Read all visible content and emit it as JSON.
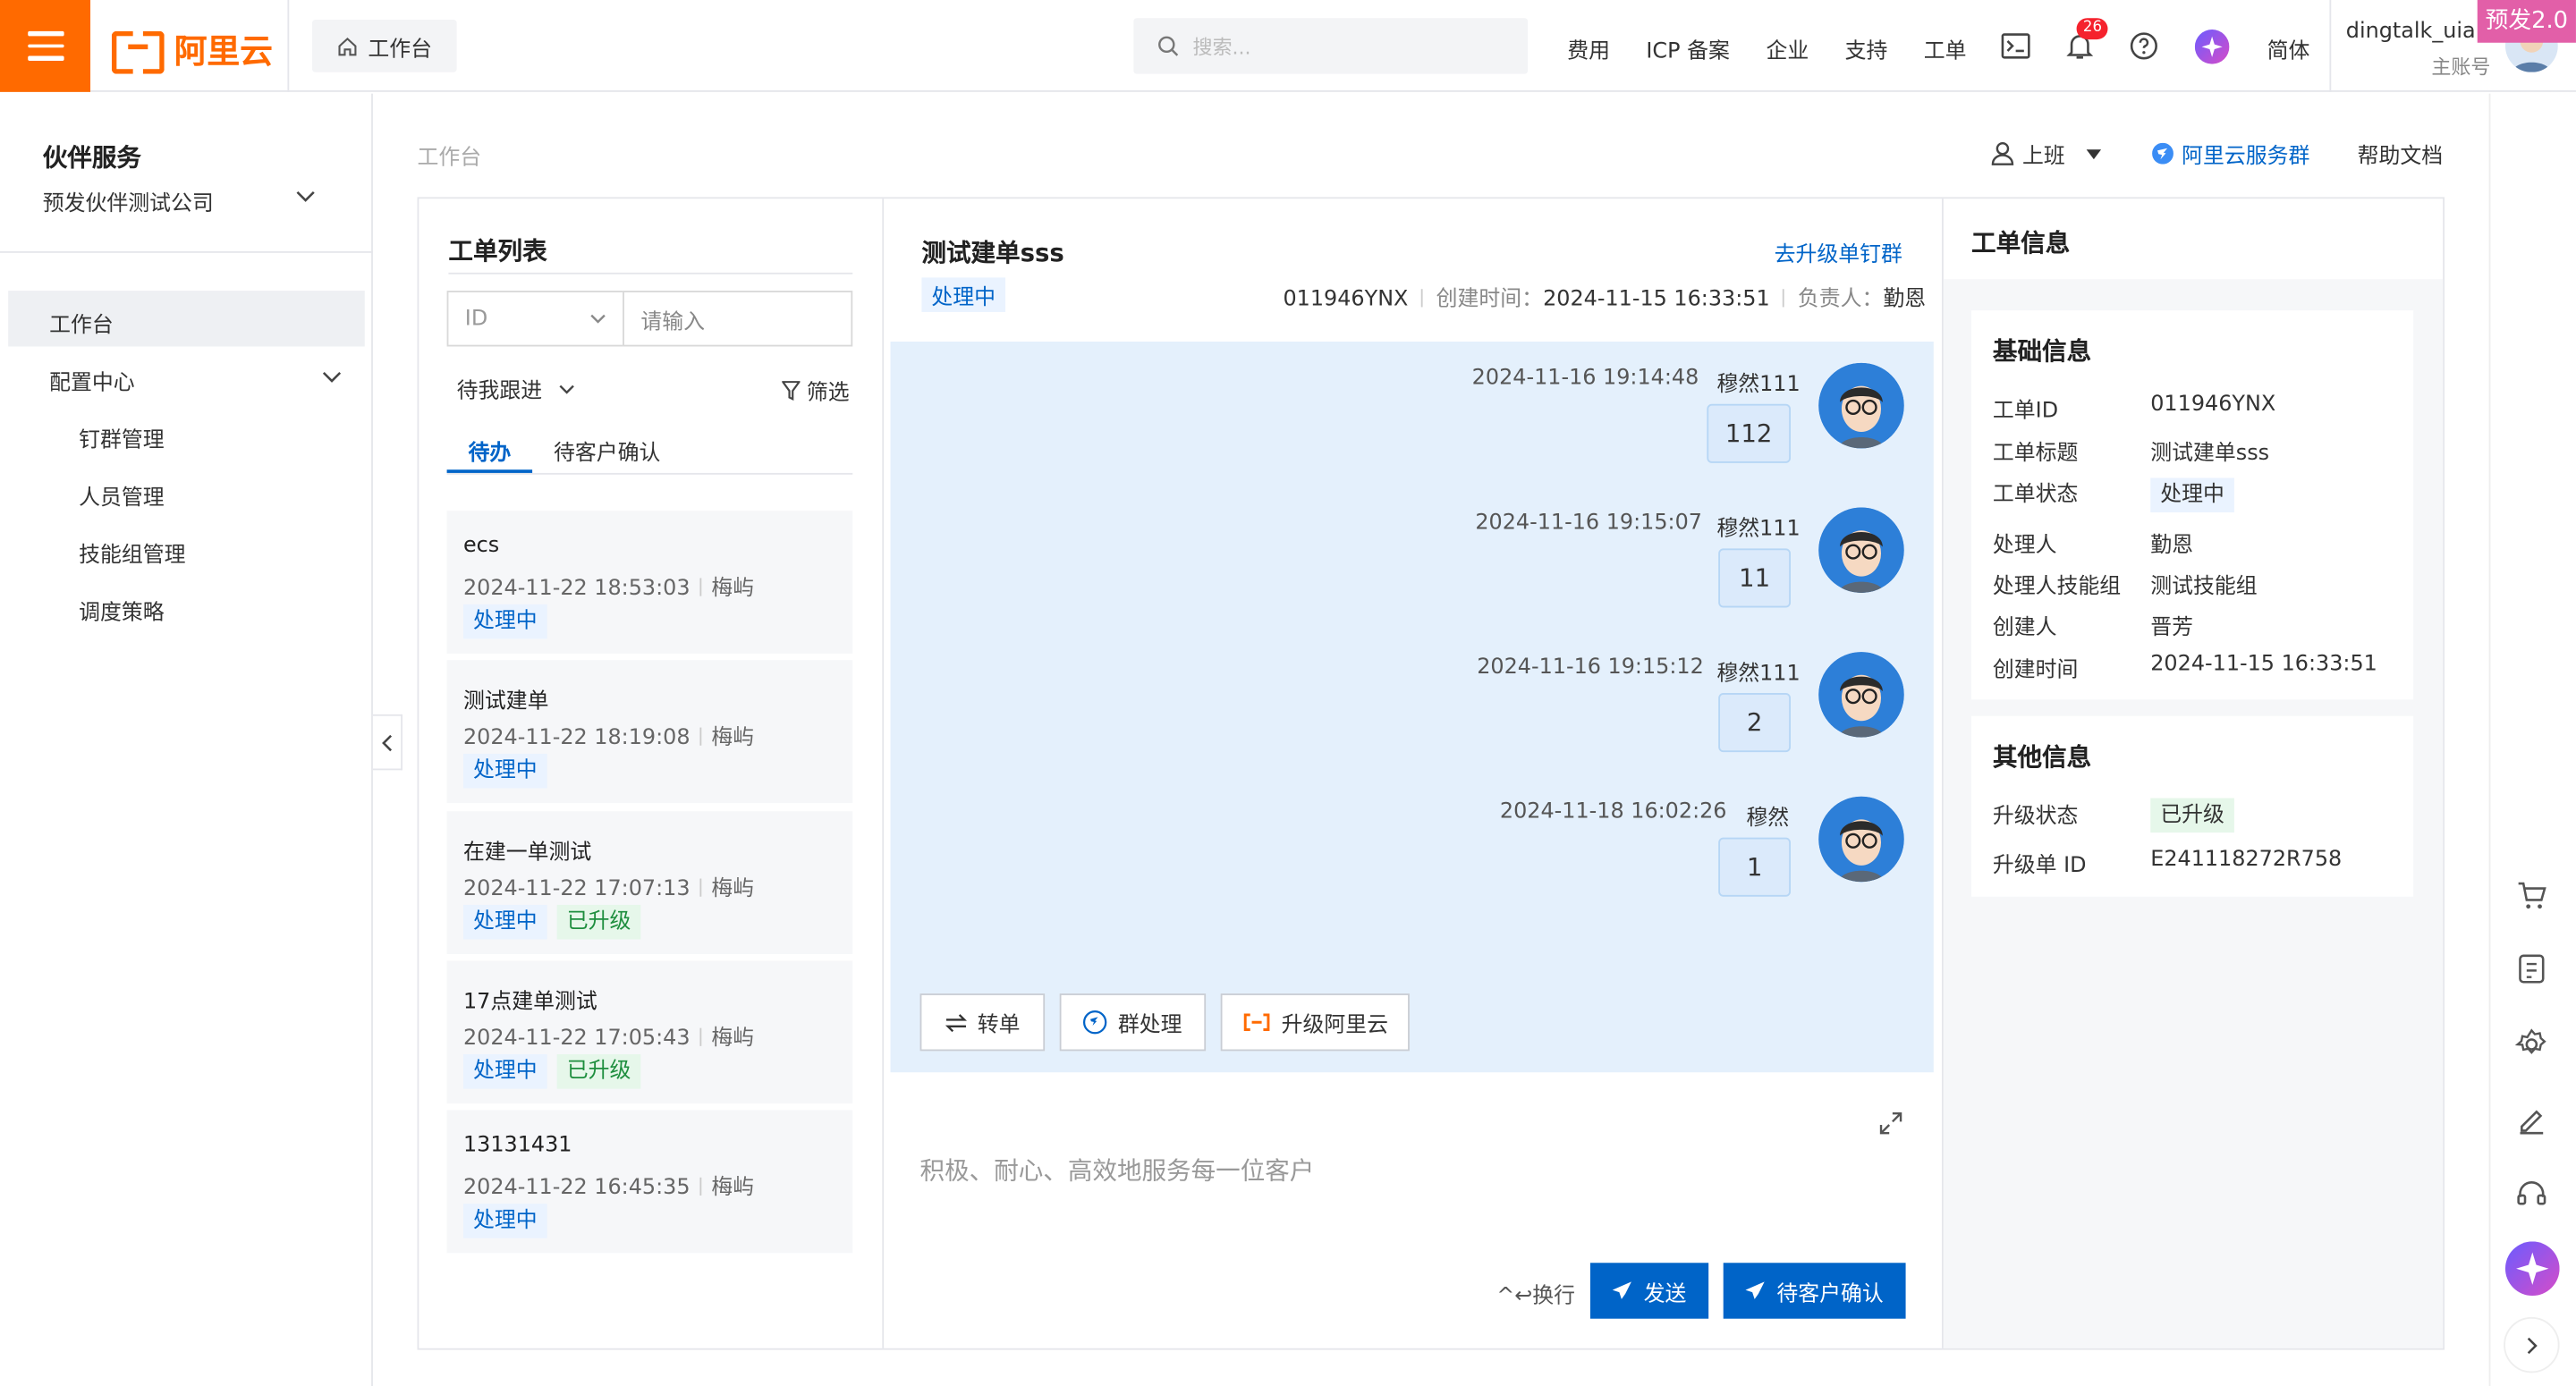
{
  "topbar": {
    "logo_text": "阿里云",
    "home_tab": "工作台",
    "search_placeholder": "搜索...",
    "nav": [
      "费用",
      "ICP 备案",
      "企业",
      "支持",
      "工单"
    ],
    "notification_count": "26",
    "language": "简体",
    "user_name": "dingtalk_uia...",
    "user_role": "主账号",
    "env_tag": "预发2.0"
  },
  "sidebar": {
    "title": "伙伴服务",
    "company": "预发伙伴测试公司",
    "items": [
      {
        "label": "工作台"
      },
      {
        "label": "配置中心"
      },
      {
        "label": "钉群管理"
      },
      {
        "label": "人员管理"
      },
      {
        "label": "技能组管理"
      },
      {
        "label": "调度策略"
      }
    ]
  },
  "header": {
    "breadcrumb": "工作台",
    "duty": "上班",
    "service_group": "阿里云服务群",
    "help": "帮助文档"
  },
  "ticket_list": {
    "title": "工单列表",
    "id_select": "ID",
    "input_placeholder": "请输入",
    "follow": "待我跟进",
    "filter": "筛选",
    "tabs": [
      "待办",
      "待客户确认"
    ],
    "items": [
      {
        "title": "ecs",
        "time": "2024-11-22 18:53:03",
        "owner": "梅屿",
        "status": "处理中",
        "upgraded": ""
      },
      {
        "title": "测试建单",
        "time": "2024-11-22 18:19:08",
        "owner": "梅屿",
        "status": "处理中",
        "upgraded": ""
      },
      {
        "title": "在建一单测试",
        "time": "2024-11-22 17:07:13",
        "owner": "梅屿",
        "status": "处理中",
        "upgraded": "已升级"
      },
      {
        "title": "17点建单测试",
        "time": "2024-11-22 17:05:43",
        "owner": "梅屿",
        "status": "处理中",
        "upgraded": "已升级"
      },
      {
        "title": "13131431",
        "time": "2024-11-22 16:45:35",
        "owner": "梅屿",
        "status": "处理中",
        "upgraded": ""
      }
    ]
  },
  "chat": {
    "title": "测试建单sss",
    "escalate_link": "去升级单钉群",
    "status": "处理中",
    "ticket_id": "011946YNX",
    "created_label": "创建时间：",
    "created": "2024-11-15 16:33:51",
    "owner_label": "负责人：",
    "owner": "勤恩",
    "messages": [
      {
        "time": "2024-11-16 19:14:48",
        "sender": "穆然111",
        "text": "112"
      },
      {
        "time": "2024-11-16 19:15:07",
        "sender": "穆然111",
        "text": "11"
      },
      {
        "time": "2024-11-16 19:15:12",
        "sender": "穆然111",
        "text": "2"
      },
      {
        "time": "2024-11-18 16:02:26",
        "sender": "穆然",
        "text": "1"
      }
    ],
    "actions": [
      "转单",
      "群处理",
      "升级阿里云"
    ],
    "compose_placeholder": "积极、耐心、高效地服务每一位客户",
    "newline_hint": "^↩换行",
    "send": "发送",
    "await_confirm": "待客户确认"
  },
  "info": {
    "title": "工单信息",
    "basic_title": "基础信息",
    "basic": [
      {
        "k": "工单ID",
        "v": "011946YNX"
      },
      {
        "k": "工单标题",
        "v": "测试建单sss"
      },
      {
        "k": "工单状态",
        "v": "处理中"
      },
      {
        "k": "处理人",
        "v": "勤恩"
      },
      {
        "k": "处理人技能组",
        "v": "测试技能组"
      },
      {
        "k": "创建人",
        "v": "晋芳"
      },
      {
        "k": "创建时间",
        "v": "2024-11-15 16:33:51"
      }
    ],
    "other_title": "其他信息",
    "other": [
      {
        "k": "升级状态",
        "v": "已升级"
      },
      {
        "k": "升级单 ID",
        "v": "E241118272R758"
      }
    ]
  },
  "colors": {
    "brand": "#ff6a00",
    "primary": "#0064c8",
    "chat_bg": "#e4f0fc",
    "upgraded": "#1e8e3e",
    "env_tag": "#e25fa8"
  },
  "icons": [
    "menu-icon",
    "home-icon",
    "search-icon",
    "terminal-icon",
    "bell-icon",
    "help-icon",
    "assistant-icon",
    "chevron-down-icon",
    "chevron-left-icon",
    "filter-icon",
    "user-icon",
    "bot-icon",
    "transfer-icon",
    "group-icon",
    "expand-icon",
    "send-icon",
    "cart-icon",
    "invoice-icon",
    "gear-icon",
    "edit-icon",
    "headset-icon",
    "chevron-right-icon"
  ]
}
